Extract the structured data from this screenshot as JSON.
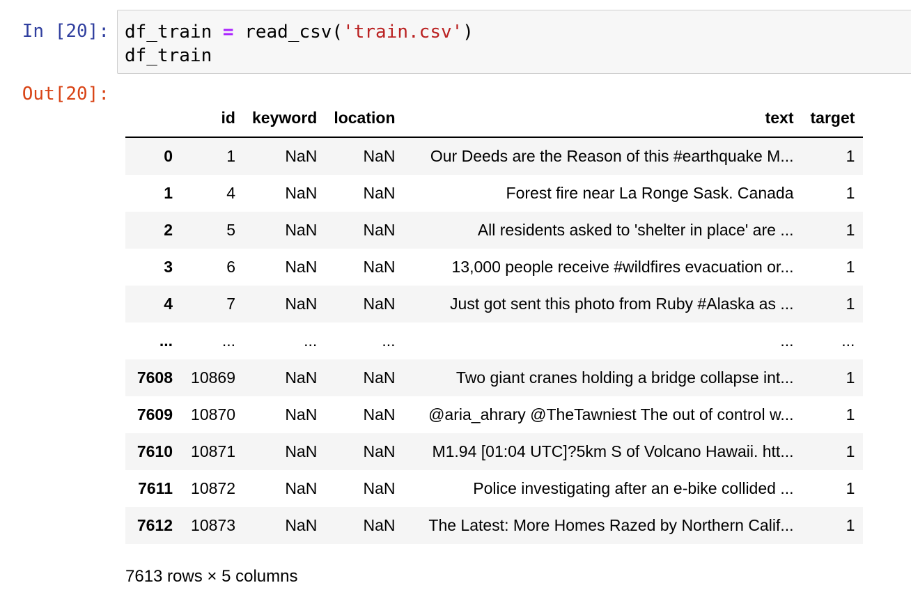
{
  "input_cell": {
    "prompt": "In [20]:",
    "code": {
      "line1": {
        "var": "df_train ",
        "op": "=",
        "call": " read_csv(",
        "str": "'train.csv'",
        "close": ")"
      },
      "line2": "df_train"
    }
  },
  "output_cell": {
    "prompt": "Out[20]:",
    "table": {
      "columns": [
        "",
        "id",
        "keyword",
        "location",
        "text",
        "target"
      ],
      "rows": [
        {
          "index": "0",
          "id": "1",
          "keyword": "NaN",
          "location": "NaN",
          "text": "Our Deeds are the Reason of this #earthquake M...",
          "target": "1"
        },
        {
          "index": "1",
          "id": "4",
          "keyword": "NaN",
          "location": "NaN",
          "text": "Forest fire near La Ronge Sask. Canada",
          "target": "1"
        },
        {
          "index": "2",
          "id": "5",
          "keyword": "NaN",
          "location": "NaN",
          "text": "All residents asked to 'shelter in place' are ...",
          "target": "1"
        },
        {
          "index": "3",
          "id": "6",
          "keyword": "NaN",
          "location": "NaN",
          "text": "13,000 people receive #wildfires evacuation or...",
          "target": "1"
        },
        {
          "index": "4",
          "id": "7",
          "keyword": "NaN",
          "location": "NaN",
          "text": "Just got sent this photo from Ruby #Alaska as ...",
          "target": "1"
        },
        {
          "index": "...",
          "id": "...",
          "keyword": "...",
          "location": "...",
          "text": "...",
          "target": "..."
        },
        {
          "index": "7608",
          "id": "10869",
          "keyword": "NaN",
          "location": "NaN",
          "text": "Two giant cranes holding a bridge collapse int...",
          "target": "1"
        },
        {
          "index": "7609",
          "id": "10870",
          "keyword": "NaN",
          "location": "NaN",
          "text": "@aria_ahrary @TheTawniest The out of control w...",
          "target": "1"
        },
        {
          "index": "7610",
          "id": "10871",
          "keyword": "NaN",
          "location": "NaN",
          "text": "M1.94 [01:04 UTC]?5km S of Volcano Hawaii. htt...",
          "target": "1"
        },
        {
          "index": "7611",
          "id": "10872",
          "keyword": "NaN",
          "location": "NaN",
          "text": "Police investigating after an e-bike collided ...",
          "target": "1"
        },
        {
          "index": "7612",
          "id": "10873",
          "keyword": "NaN",
          "location": "NaN",
          "text": "The Latest: More Homes Razed by Northern Calif...",
          "target": "1"
        }
      ]
    },
    "shape_note": "7613 rows × 5 columns"
  },
  "colors": {
    "in_prompt": "#303f9f",
    "out_prompt": "#d84315",
    "input_background": "#f7f7f7",
    "input_border": "#cfcfcf",
    "striped_row": "#f5f5f5",
    "operator": "#aa22ff",
    "string": "#ba2121"
  }
}
